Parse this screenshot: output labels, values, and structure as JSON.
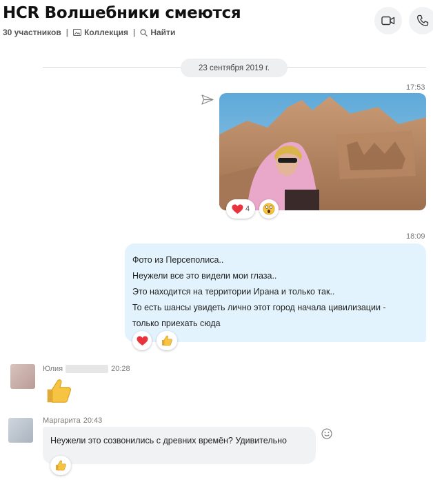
{
  "header": {
    "title": "HCR Волшебники смеются",
    "participants": "30 участников",
    "sep1": "|",
    "collection": "Коллекция",
    "sep2": "|",
    "find": "Найти"
  },
  "icons": {
    "video": "video-camera-icon",
    "call": "phone-icon",
    "collection": "gallery-icon",
    "find": "search-icon",
    "send": "sent-icon",
    "emoji": "smiley-icon"
  },
  "date_separator": "23 сентября 2019 г.",
  "messages": {
    "photo": {
      "time": "17:53",
      "heart_count": "4"
    },
    "text_out": {
      "time": "18:09",
      "lines": [
        "Фото из Персеполиса..",
        "Неужели все это видели мои глаза..",
        "Это находится на территории Ирана и только так..",
        "То есть шансы увидеть лично этот город начала цивилизации -",
        "только приехать сюда"
      ]
    },
    "yulia": {
      "sender": "Юлия",
      "time": "20:28"
    },
    "margarita": {
      "sender": "Маргарита",
      "time": "20:43",
      "text": "Неужели это созвонились с древних времён? Удивительно"
    }
  },
  "colors": {
    "outgoing_bubble": "#e3f3fd",
    "incoming_bubble": "#f1f2f4",
    "heart": "#e8323c",
    "thumb": "#f7c342"
  }
}
